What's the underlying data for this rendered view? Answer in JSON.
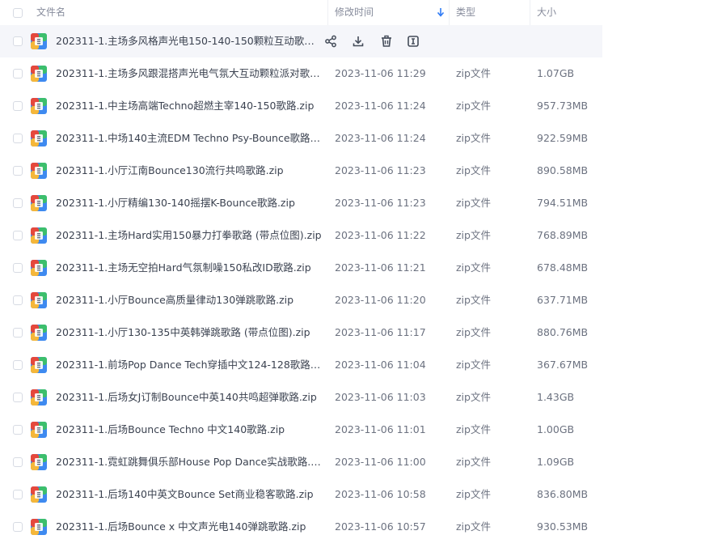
{
  "header": {
    "name": "文件名",
    "time": "修改时间",
    "type": "类型",
    "size": "大小"
  },
  "colors": {
    "zip_red": "#e5483c",
    "zip_green": "#3cbf6c",
    "zip_yellow": "#f5b73a",
    "zip_blue": "#3e8af0",
    "sort_arrow": "#2f7bf5"
  },
  "hover_actions": [
    "share-icon",
    "download-icon",
    "delete-icon",
    "more-icon"
  ],
  "files": [
    {
      "name": "202311-1.主场多风格声光电150-140-150颗粒互动歌路....",
      "time": "",
      "type": "",
      "size": ""
    },
    {
      "name": "202311-1.主场多风跟混搭声光电气氛大互动颗粒派对歌路.z...",
      "time": "2023-11-06 11:29",
      "type": "zip文件",
      "size": "1.07GB"
    },
    {
      "name": "202311-1.中主场高端Techno超燃主宰140-150歌路.zip",
      "time": "2023-11-06 11:24",
      "type": "zip文件",
      "size": "957.73MB"
    },
    {
      "name": "202311-1.中场140主流EDM Techno Psy-Bounce歌路.zip",
      "time": "2023-11-06 11:24",
      "type": "zip文件",
      "size": "922.59MB"
    },
    {
      "name": "202311-1.小厅江南Bounce130流行共鸣歌路.zip",
      "time": "2023-11-06 11:23",
      "type": "zip文件",
      "size": "890.58MB"
    },
    {
      "name": "202311-1.小厅精编130-140摇摆K-Bounce歌路.zip",
      "time": "2023-11-06 11:23",
      "type": "zip文件",
      "size": "794.51MB"
    },
    {
      "name": "202311-1.主场Hard实用150暴力打拳歌路 (带点位图).zip",
      "time": "2023-11-06 11:22",
      "type": "zip文件",
      "size": "768.89MB"
    },
    {
      "name": "202311-1.主场无空拍Hard气氛制噪150私改ID歌路.zip",
      "time": "2023-11-06 11:21",
      "type": "zip文件",
      "size": "678.48MB"
    },
    {
      "name": "202311-1.小厅Bounce高质量律动130弹跳歌路.zip",
      "time": "2023-11-06 11:20",
      "type": "zip文件",
      "size": "637.71MB"
    },
    {
      "name": "202311-1.小厅130-135中英韩弹跳歌路 (带点位图).zip",
      "time": "2023-11-06 11:17",
      "type": "zip文件",
      "size": "880.76MB"
    },
    {
      "name": "202311-1.前场Pop Dance Tech穿插中文124-128歌路.zip",
      "time": "2023-11-06 11:04",
      "type": "zip文件",
      "size": "367.67MB"
    },
    {
      "name": "202311-1.后场女J订制Bounce中英140共鸣超弹歌路.zip",
      "time": "2023-11-06 11:03",
      "type": "zip文件",
      "size": "1.43GB"
    },
    {
      "name": "202311-1.后场Bounce Techno 中文140歌路.zip",
      "time": "2023-11-06 11:01",
      "type": "zip文件",
      "size": "1.00GB"
    },
    {
      "name": "202311-1.霓虹跳舞俱乐部House Pop Dance实战歌路.zip",
      "time": "2023-11-06 11:00",
      "type": "zip文件",
      "size": "1.09GB"
    },
    {
      "name": "202311-1.后场140中英文Bounce Set商业稳客歌路.zip",
      "time": "2023-11-06 10:58",
      "type": "zip文件",
      "size": "836.80MB"
    },
    {
      "name": "202311-1.后场Bounce x 中文声光电140弹跳歌路.zip",
      "time": "2023-11-06 10:57",
      "type": "zip文件",
      "size": "930.53MB"
    }
  ]
}
